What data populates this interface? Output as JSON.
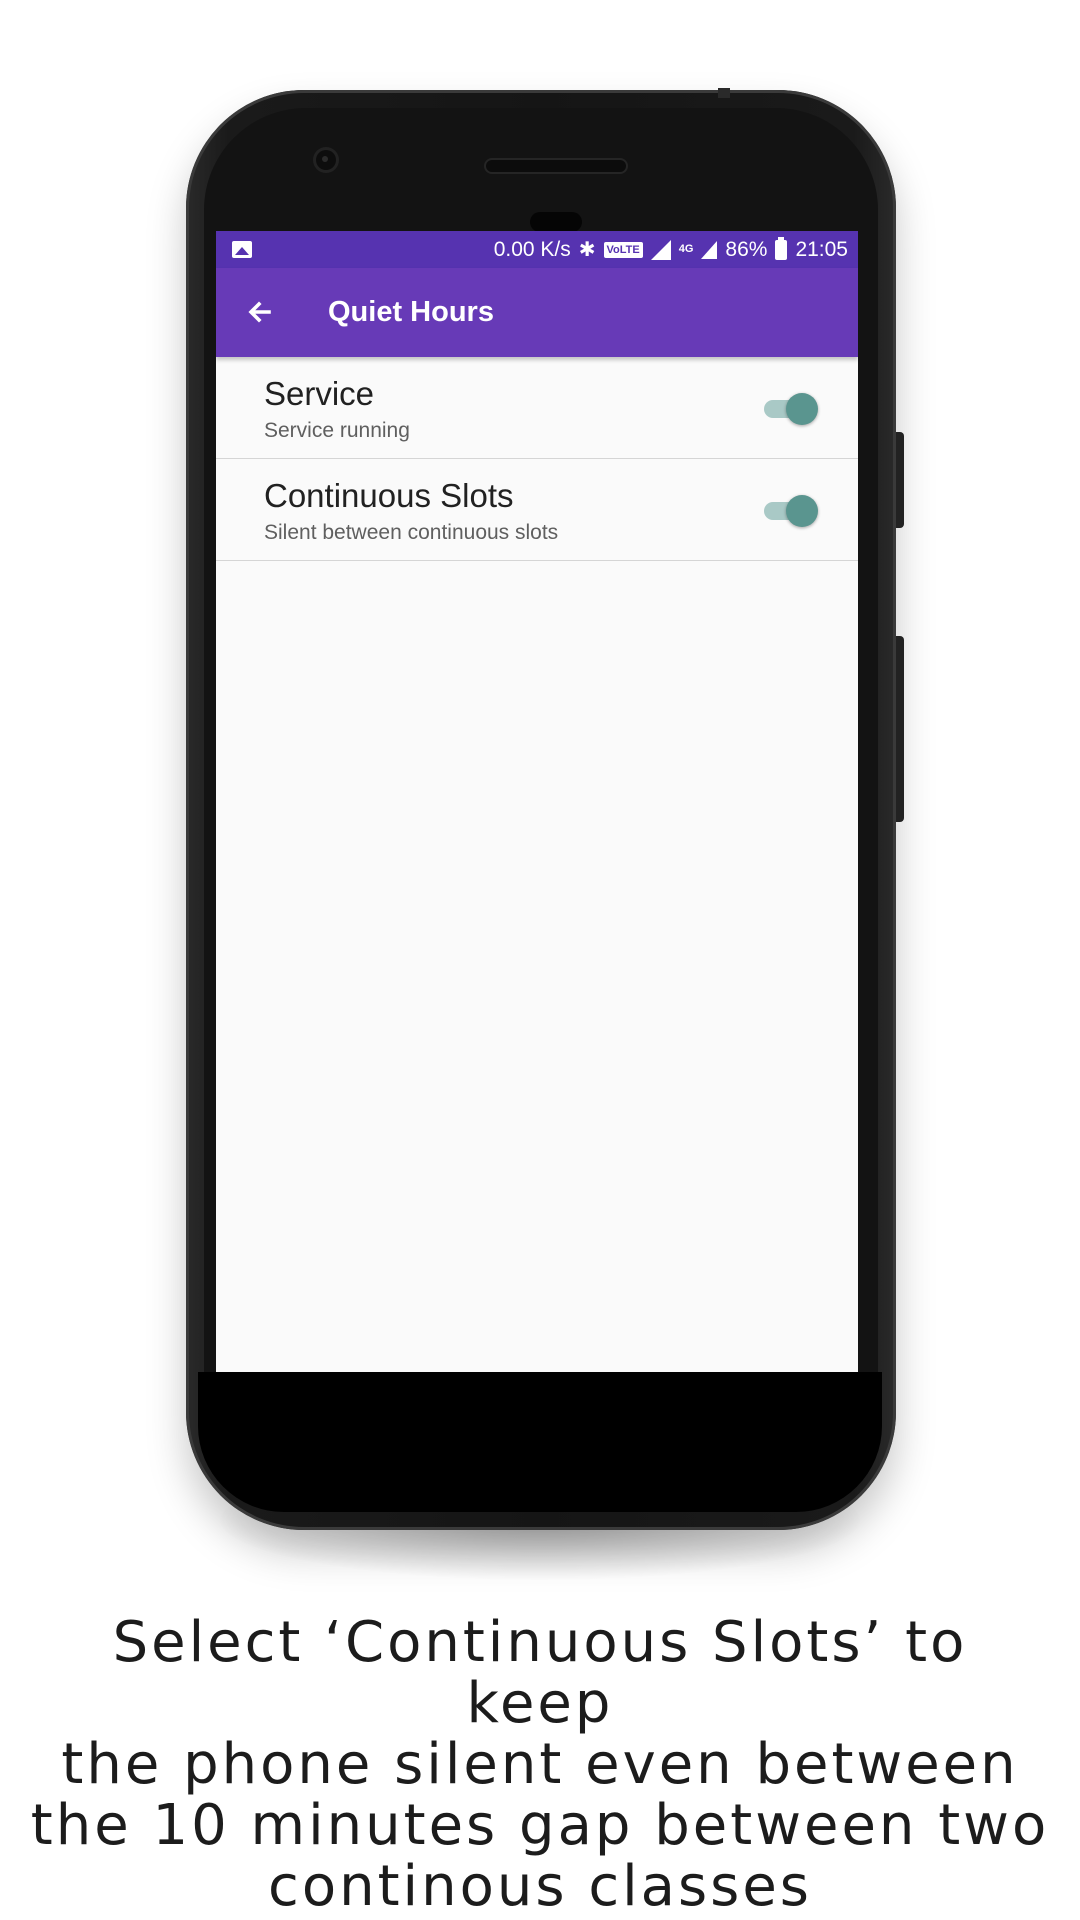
{
  "status_bar": {
    "net_speed": "0.00 K/s",
    "volte_badge": "VoLTE",
    "network_type": "4G",
    "battery_percent": "86%",
    "time": "21:05"
  },
  "app_bar": {
    "title": "Quiet Hours",
    "back_icon": "arrow-back-icon"
  },
  "colors": {
    "status_bar": "#5633b0",
    "app_bar": "#673ab7",
    "switch_thumb": "#5a958f",
    "switch_track": "#a9c9c6"
  },
  "preferences": [
    {
      "title": "Service",
      "summary": "Service running",
      "enabled": true
    },
    {
      "title": "Continuous Slots",
      "summary": "Silent between continuous slots",
      "enabled": true
    }
  ],
  "caption": {
    "lines": [
      "Select ‘Continuous Slots’ to keep",
      "the phone silent even between",
      "the 10 minutes gap between two",
      "continous classes"
    ]
  }
}
